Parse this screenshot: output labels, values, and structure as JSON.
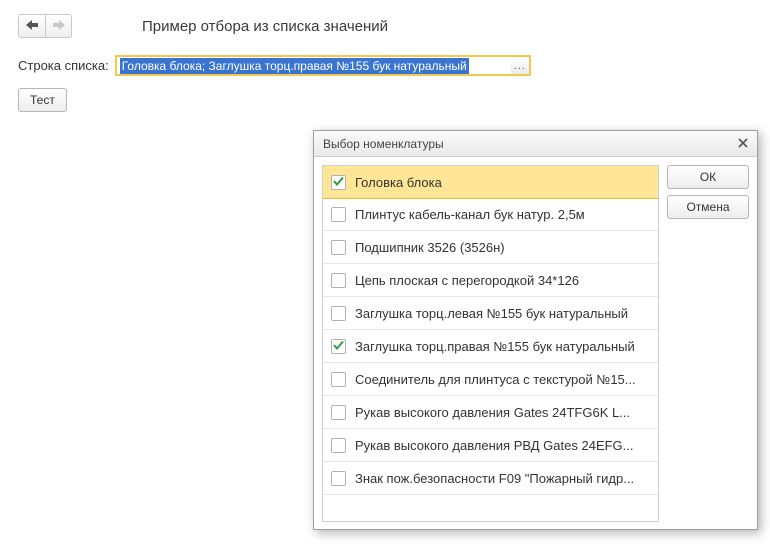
{
  "header": {
    "title": "Пример отбора из списка значений"
  },
  "field": {
    "label": "Строка списка:",
    "value": "Головка блока; Заглушка торц.правая №155 бук натуральный",
    "picker_label": "..."
  },
  "test_button": {
    "label": "Тест"
  },
  "dialog": {
    "title": "Выбор номенклатуры",
    "ok_label": "ОК",
    "cancel_label": "Отмена",
    "items": [
      {
        "label": "Головка блока",
        "checked": true,
        "selected": true
      },
      {
        "label": "Плинтус кабель-канал бук натур. 2,5м",
        "checked": false,
        "selected": false
      },
      {
        "label": "Подшипник 3526 (3526н)",
        "checked": false,
        "selected": false
      },
      {
        "label": "Цепь плоская с перегородкой 34*126",
        "checked": false,
        "selected": false
      },
      {
        "label": "Заглушка торц.левая №155 бук натуральный",
        "checked": false,
        "selected": false
      },
      {
        "label": "Заглушка торц.правая №155 бук натуральный",
        "checked": true,
        "selected": false
      },
      {
        "label": "Соединитель для плинтуса с текстурой №15...",
        "checked": false,
        "selected": false
      },
      {
        "label": "Рукав высокого давления Gates 24TFG6K L...",
        "checked": false,
        "selected": false
      },
      {
        "label": "Рукав высокого давления РВД Gates 24EFG...",
        "checked": false,
        "selected": false
      },
      {
        "label": "Знак пож.безопасности F09 \"Пожарный гидр...",
        "checked": false,
        "selected": false
      }
    ]
  }
}
